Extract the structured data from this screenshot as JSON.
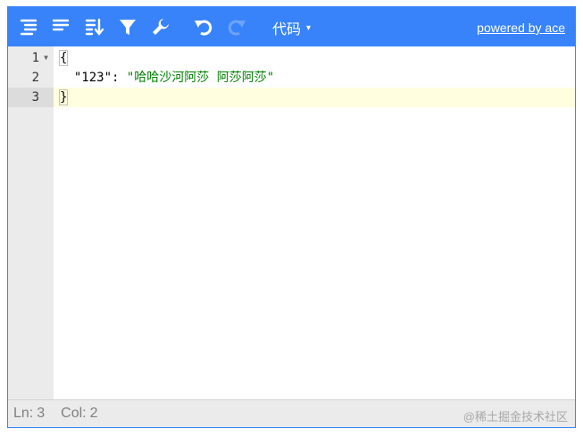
{
  "toolbar": {
    "buttons": [
      {
        "name": "format-icon"
      },
      {
        "name": "compact-icon"
      },
      {
        "name": "sort-icon"
      },
      {
        "name": "filter-icon"
      },
      {
        "name": "repair-icon"
      },
      {
        "name": "undo-icon"
      },
      {
        "name": "redo-icon"
      }
    ],
    "mode_label": "代码",
    "mode_caret": "▾",
    "powered_label": "powered by ace"
  },
  "gutter": {
    "lines": [
      "1",
      "2",
      "3"
    ]
  },
  "code": {
    "line1_brace": "{",
    "line2_indent": "  ",
    "line2_key": "\"123\"",
    "line2_colon": ": ",
    "line2_value": "\"哈哈沙河阿莎 阿莎阿莎\"",
    "line3_brace": "}"
  },
  "status": {
    "ln_label": "Ln:",
    "ln_value": "3",
    "col_label": "Col:",
    "col_value": "2",
    "watermark": "@稀土掘金技术社区"
  },
  "colors": {
    "accent": "#3883fa",
    "active_line": "#ffffe0",
    "string": "#008000"
  }
}
